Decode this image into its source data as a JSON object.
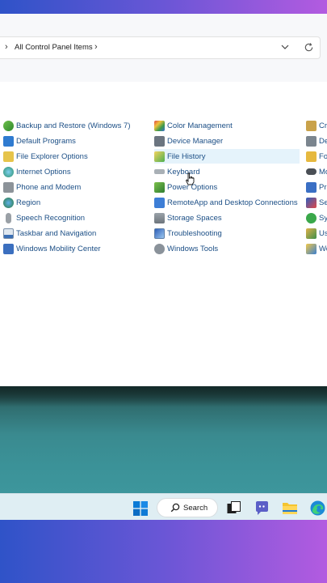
{
  "address_bar": {
    "path": "All Control Panel Items"
  },
  "items_col1": [
    {
      "label": "Backup and Restore (Windows 7)",
      "icon": "backup-icon"
    },
    {
      "label": "Default Programs",
      "icon": "default-programs-icon"
    },
    {
      "label": "File Explorer Options",
      "icon": "folder-options-icon"
    },
    {
      "label": "Internet Options",
      "icon": "internet-options-icon"
    },
    {
      "label": "Phone and Modem",
      "icon": "phone-modem-icon"
    },
    {
      "label": "Region",
      "icon": "region-icon"
    },
    {
      "label": "Speech Recognition",
      "icon": "microphone-icon"
    },
    {
      "label": "Taskbar and Navigation",
      "icon": "taskbar-icon"
    },
    {
      "label": "Windows Mobility Center",
      "icon": "mobility-center-icon"
    }
  ],
  "items_col2": [
    {
      "label": "Color Management",
      "icon": "color-management-icon"
    },
    {
      "label": "Device Manager",
      "icon": "device-manager-icon"
    },
    {
      "label": "File History",
      "icon": "file-history-icon",
      "hovered": true
    },
    {
      "label": "Keyboard",
      "icon": "keyboard-icon"
    },
    {
      "label": "Power Options",
      "icon": "power-options-icon"
    },
    {
      "label": "RemoteApp and Desktop Connections",
      "icon": "remoteapp-icon"
    },
    {
      "label": "Storage Spaces",
      "icon": "storage-spaces-icon"
    },
    {
      "label": "Troubleshooting",
      "icon": "troubleshooting-icon"
    },
    {
      "label": "Windows Tools",
      "icon": "windows-tools-icon"
    }
  ],
  "items_col3": [
    {
      "label": "Cre",
      "icon": "credential-icon"
    },
    {
      "label": "De",
      "icon": "devices-icon"
    },
    {
      "label": "Fo",
      "icon": "fonts-icon"
    },
    {
      "label": "Mo",
      "icon": "mouse-icon"
    },
    {
      "label": "Pro",
      "icon": "programs-icon"
    },
    {
      "label": "Se",
      "icon": "security-icon"
    },
    {
      "label": "Syn",
      "icon": "sync-icon"
    },
    {
      "label": "Us",
      "icon": "user-accounts-icon"
    },
    {
      "label": "Wo",
      "icon": "work-folders-icon"
    }
  ],
  "taskbar": {
    "search_label": "Search"
  },
  "colors": {
    "link": "#1c4f86",
    "hover_bg": "#e5f3fb",
    "accent": "#0078d4"
  }
}
